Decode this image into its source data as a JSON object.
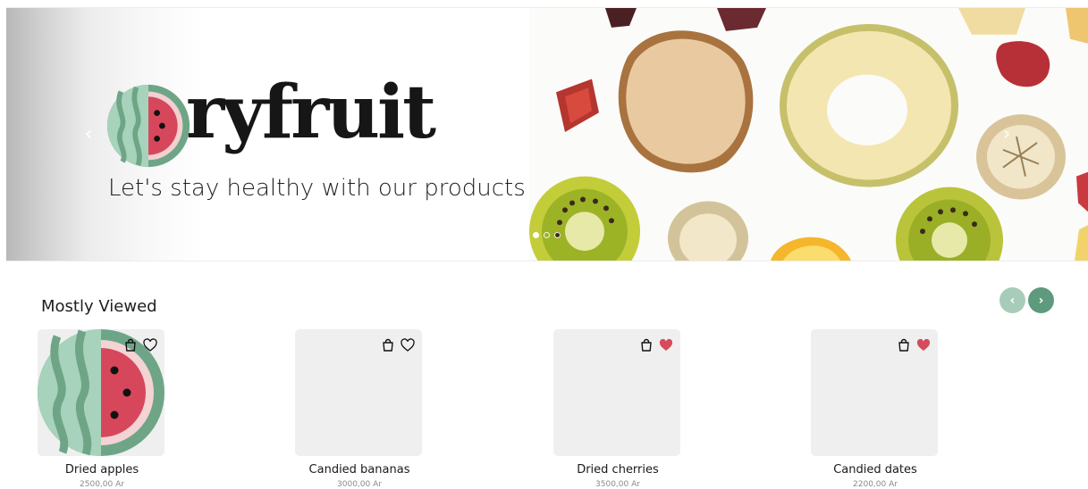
{
  "hero": {
    "brand": "ryfruit",
    "tagline": "Let's stay healthy with our products",
    "prev_icon": "‹",
    "next_icon": "›",
    "slides": [
      {
        "active": true
      },
      {
        "active": false
      },
      {
        "active": false
      }
    ]
  },
  "section": {
    "title": "Mostly Viewed",
    "prev_icon": "‹",
    "next_icon": "›"
  },
  "products": [
    {
      "name": "Dried apples",
      "price": "2500,00 Ar",
      "favorite": false,
      "image": "watermelon-logo"
    },
    {
      "name": "Candied bananas",
      "price": "3000,00 Ar",
      "favorite": false,
      "image": "placeholder"
    },
    {
      "name": "Dried cherries",
      "price": "3500,00 Ar",
      "favorite": true,
      "image": "placeholder"
    },
    {
      "name": "Candied dates",
      "price": "2200,00 Ar",
      "favorite": true,
      "image": "placeholder"
    }
  ],
  "colors": {
    "accent_green": "#5e9a7d",
    "accent_green_light": "#a7ccb9",
    "favorite_red": "#d64a5c",
    "card_bg": "#efefef"
  }
}
